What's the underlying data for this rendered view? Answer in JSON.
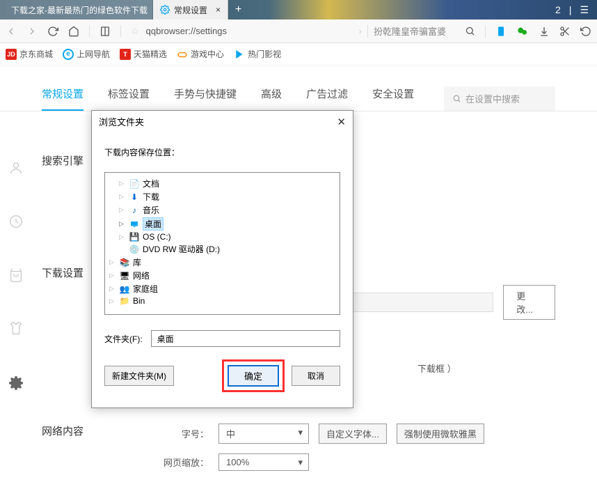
{
  "tabs": {
    "t1_icon_bg": "#3a7a3a",
    "t1_label": "下载之家-最新最热门的绿色软件下载",
    "t2_label": "常规设置",
    "add": "+",
    "right_num": "2",
    "right_pipe": "|"
  },
  "nav": {
    "address": "qqbrowser://settings",
    "hint": "扮乾隆皇帝骗富婆"
  },
  "bookmarks": {
    "b1": "京东商城",
    "b2": "上网导航",
    "b3": "天猫精选",
    "b4": "游戏中心",
    "b5": "热门影视"
  },
  "settings_tabs": {
    "t1": "常规设置",
    "t2": "标签设置",
    "t3": "手势与快捷键",
    "t4": "高级",
    "t5": "广告过滤",
    "t6": "安全设置",
    "search_ph": "在设置中搜索"
  },
  "sections": {
    "search": "搜索引擎",
    "download": "下载设置",
    "network": "网络内容"
  },
  "download": {
    "change": "更改...",
    "dlbox_text": "下载框 ）"
  },
  "network": {
    "font_label": "字号：",
    "font_value": "中",
    "custom_font": "自定义字体...",
    "force_yahei": "强制使用微软雅黑",
    "zoom_label": "网页缩放：",
    "zoom_value": "100%"
  },
  "dialog": {
    "title": "浏览文件夹",
    "subtitle": "下载内容保存位置：",
    "folder_label": "文件夹(F):",
    "folder_value": "桌面",
    "new_folder": "新建文件夹(M)",
    "ok": "确定",
    "cancel": "取消",
    "tree": {
      "i1": "文档",
      "i2": "下载",
      "i3": "音乐",
      "i4": "桌面",
      "i5": "OS (C:)",
      "i6": "DVD RW 驱动器 (D:)",
      "i7": "库",
      "i8": "网络",
      "i9": "家庭组",
      "i10": "Bin"
    }
  }
}
